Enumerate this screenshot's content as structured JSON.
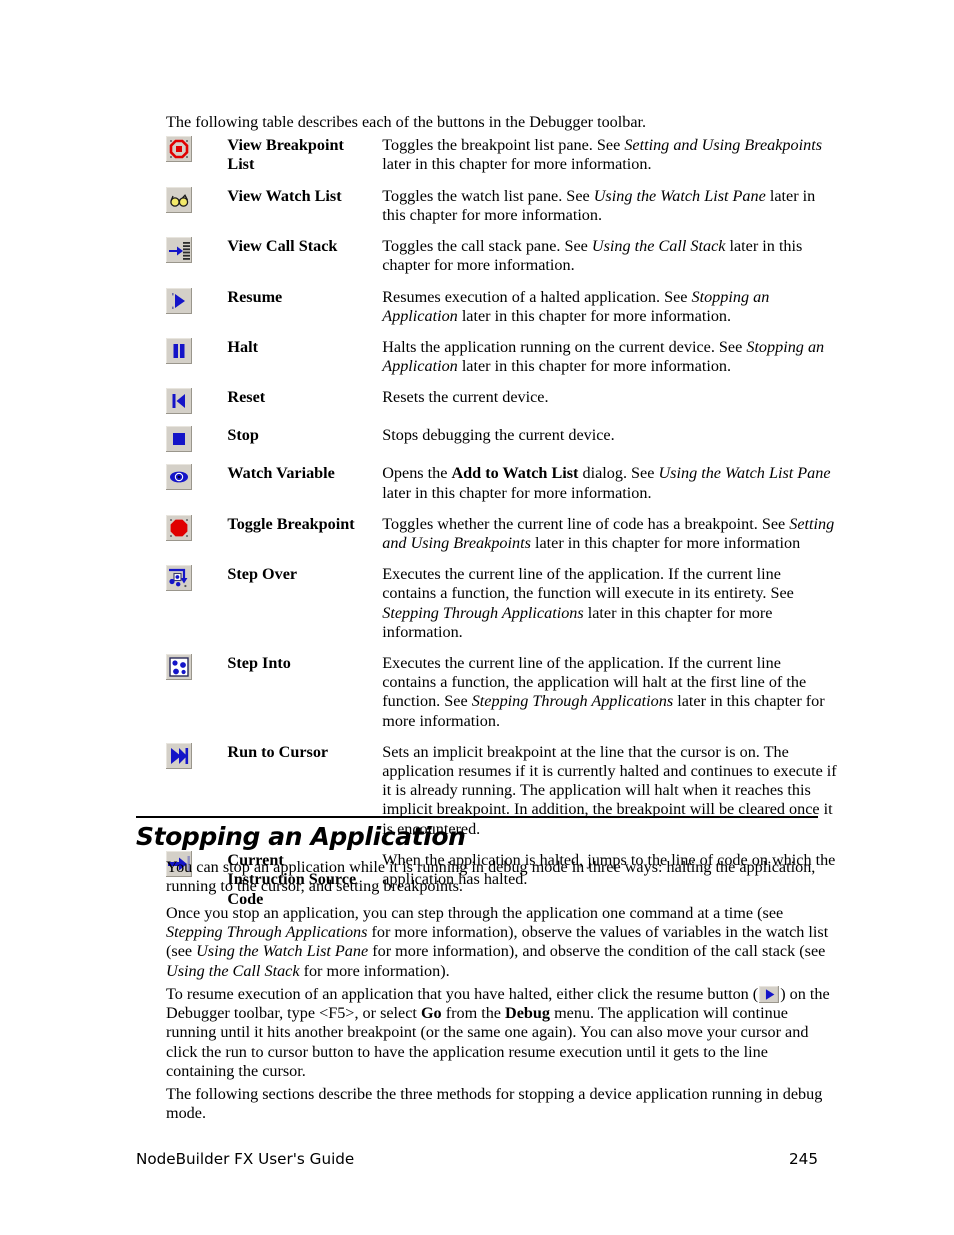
{
  "page": {
    "intro": "The following table describes each of the buttons in the Debugger toolbar.",
    "heading": "Stopping an Application",
    "footer_title": "NodeBuilder FX User's Guide",
    "footer_page": "245"
  },
  "colors": {
    "button_face": "#d4d0c8",
    "icon_blue": "#1414c8",
    "icon_red": "#e00000",
    "text": "#000000"
  },
  "toolbar_table": {
    "rows": [
      {
        "icon": "view-breakpoint-list-icon",
        "name_lines": [
          "View Breakpoint",
          "List"
        ],
        "desc": [
          {
            "t": "Toggles the breakpoint list pane.  See ",
            "s": "normal"
          },
          {
            "t": "Setting and Using Breakpoints",
            "s": "italic"
          },
          {
            "t": " later in this chapter for more information.",
            "s": "normal"
          }
        ]
      },
      {
        "icon": "view-watch-list-icon",
        "name_lines": [
          "View Watch List"
        ],
        "desc": [
          {
            "t": "Toggles the watch list pane.  See ",
            "s": "normal"
          },
          {
            "t": "Using the Watch List Pane",
            "s": "italic"
          },
          {
            "t": " later in this chapter for more information.",
            "s": "normal"
          }
        ]
      },
      {
        "icon": "view-call-stack-icon",
        "name_lines": [
          "View Call Stack"
        ],
        "desc": [
          {
            "t": "Toggles the call stack pane.  See ",
            "s": "normal"
          },
          {
            "t": "Using the Call Stack",
            "s": "italic"
          },
          {
            "t": " later in this chapter for more information.",
            "s": "normal"
          }
        ]
      },
      {
        "icon": "resume-icon",
        "name_lines": [
          "Resume"
        ],
        "desc": [
          {
            "t": "Resumes execution of a halted application.  See ",
            "s": "normal"
          },
          {
            "t": "Stopping an Application",
            "s": "italic"
          },
          {
            "t": " later in this chapter for more information.",
            "s": "normal"
          }
        ]
      },
      {
        "icon": "halt-icon",
        "name_lines": [
          "Halt"
        ],
        "desc": [
          {
            "t": "Halts the application running on the current device.  See ",
            "s": "normal"
          },
          {
            "t": "Stopping an Application",
            "s": "italic"
          },
          {
            "t": " later in this chapter for more information.",
            "s": "normal"
          }
        ]
      },
      {
        "icon": "reset-icon",
        "name_lines": [
          "Reset"
        ],
        "desc": [
          {
            "t": "Resets the current device.",
            "s": "normal"
          }
        ]
      },
      {
        "icon": "stop-icon",
        "name_lines": [
          "Stop"
        ],
        "desc": [
          {
            "t": "Stops debugging the current device.",
            "s": "normal"
          }
        ]
      },
      {
        "icon": "watch-variable-icon",
        "name_lines": [
          "Watch Variable"
        ],
        "desc": [
          {
            "t": "Opens the ",
            "s": "normal"
          },
          {
            "t": "Add to Watch List",
            "s": "bold"
          },
          {
            "t": " dialog.  See ",
            "s": "normal"
          },
          {
            "t": "Using the Watch List Pane",
            "s": "italic"
          },
          {
            "t": " later in this chapter for more information.",
            "s": "normal"
          }
        ]
      },
      {
        "icon": "toggle-breakpoint-icon",
        "name_lines": [
          "Toggle Breakpoint"
        ],
        "desc": [
          {
            "t": "Toggles whether the current line of code has a breakpoint.  See ",
            "s": "normal"
          },
          {
            "t": "Setting and Using Breakpoints",
            "s": "italic"
          },
          {
            "t": " later in this chapter for more information",
            "s": "normal"
          }
        ]
      },
      {
        "icon": "step-over-icon",
        "name_lines": [
          "Step Over"
        ],
        "desc": [
          {
            "t": "Executes the current line of the application.  If the current line contains a function, the function will execute in its entirety.  See ",
            "s": "normal"
          },
          {
            "t": "Stepping Through Applications",
            "s": "italic"
          },
          {
            "t": " later in this chapter for more information.",
            "s": "normal"
          }
        ]
      },
      {
        "icon": "step-into-icon",
        "name_lines": [
          "Step Into"
        ],
        "desc": [
          {
            "t": "Executes the current line of the application.  If the current line contains a function, the application will halt at the first line of the function.  See ",
            "s": "normal"
          },
          {
            "t": "Stepping Through Applications",
            "s": "italic"
          },
          {
            "t": " later in this chapter for more information.",
            "s": "normal"
          }
        ]
      },
      {
        "icon": "run-to-cursor-icon",
        "name_lines": [
          "Run to Cursor"
        ],
        "desc": [
          {
            "t": "Sets an implicit breakpoint at the line that the cursor is on.  The application resumes if it is currently halted and continues to execute if it is already running.  The application will halt when it reaches this implicit breakpoint.  In addition, the breakpoint will be cleared once it is encountered.",
            "s": "normal"
          }
        ]
      },
      {
        "icon": "current-instruction-source-code-icon",
        "name_lines": [
          "Current",
          "Instruction Source",
          "Code"
        ],
        "desc": [
          {
            "t": "When the application is halted, jumps to the line of code on which the application has halted.",
            "s": "normal"
          }
        ]
      }
    ]
  },
  "body": {
    "paragraphs": [
      {
        "id": "p1",
        "runs": [
          {
            "t": "You can stop an application while it is running in debug mode in three ways: halting the application, running to the cursor, and setting breakpoints.",
            "s": "normal"
          }
        ]
      },
      {
        "id": "p2",
        "runs": [
          {
            "t": "Once you stop an application, you can step through the application one command at a time (see ",
            "s": "normal"
          },
          {
            "t": "Stepping Through Applications",
            "s": "italic"
          },
          {
            "t": " for more information), observe the values of variables in the watch list (see ",
            "s": "normal"
          },
          {
            "t": "Using the Watch List Pane",
            "s": "italic"
          },
          {
            "t": " for more information), and observe the condition of the call stack (see ",
            "s": "normal"
          },
          {
            "t": "Using the Call Stack",
            "s": "italic"
          },
          {
            "t": " for more information).",
            "s": "normal"
          }
        ]
      },
      {
        "id": "p3",
        "runs": [
          {
            "t": "To resume execution of an application that you have halted, either click the resume button (",
            "s": "normal"
          },
          {
            "t": "@resume-icon",
            "s": "icon"
          },
          {
            "t": ") on the Debugger toolbar, type <F5>, or select ",
            "s": "normal"
          },
          {
            "t": "Go",
            "s": "bold"
          },
          {
            "t": " from the ",
            "s": "normal"
          },
          {
            "t": "Debug",
            "s": "bold"
          },
          {
            "t": " menu.  The application will continue running until it hits another breakpoint (or the same one again).  You can also move your cursor and click the run to cursor button to have the application resume execution until it gets to the line containing the cursor.",
            "s": "normal"
          }
        ]
      },
      {
        "id": "p4",
        "runs": [
          {
            "t": "The following sections describe the three methods for stopping a device application running in debug mode.",
            "s": "normal"
          }
        ]
      }
    ]
  }
}
